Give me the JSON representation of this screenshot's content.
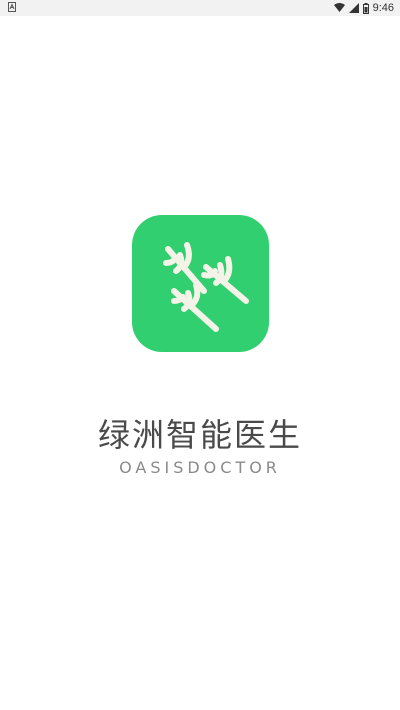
{
  "status_bar": {
    "time": "9:46",
    "icons": [
      "notification-icon",
      "wifi-icon",
      "signal-icon",
      "battery-icon"
    ]
  },
  "splash": {
    "app_name": "绿洲智能医生",
    "app_subtitle": "OASISDOCTOR",
    "icon": "cactus-logo-icon",
    "brand_color": "#32cf70"
  }
}
